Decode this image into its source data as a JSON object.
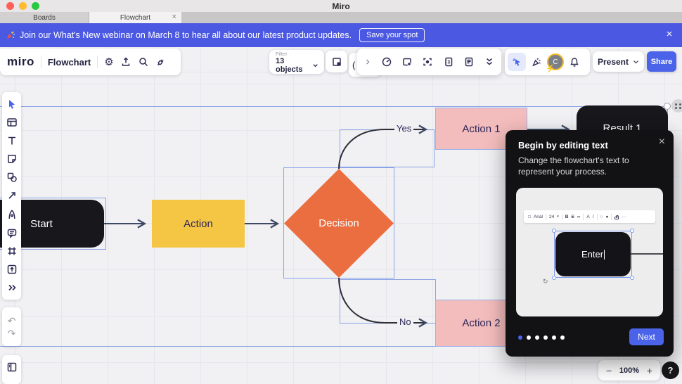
{
  "window": {
    "title": "Miro"
  },
  "tabs": {
    "items": [
      {
        "label": "Boards"
      },
      {
        "label": "Flowchart",
        "close": "×"
      }
    ]
  },
  "banner": {
    "message": "Join our What's New webinar on March 8 to hear all about our latest product updates.",
    "cta": "Save your spot",
    "close": "×"
  },
  "app_toolbar": {
    "logo": "miro",
    "board_title": "Flowchart"
  },
  "filter": {
    "label": "Filter",
    "value": "13 objects"
  },
  "hidden_panel": {
    "partial_text": "("
  },
  "collab_bar": {
    "present": "Present",
    "share": "Share",
    "avatar_initial": "C"
  },
  "canvas": {
    "zoom_out": "−",
    "zoom_value": "100%",
    "zoom_in": "+",
    "help": "?",
    "flowchart": {
      "nodes": [
        {
          "label": "Start",
          "type": "terminator",
          "color": "#17171c"
        },
        {
          "label": "Action",
          "type": "process",
          "color": "#f5c644"
        },
        {
          "label": "Decision",
          "type": "decision",
          "color": "#eb6e41"
        },
        {
          "label": "Action 1",
          "type": "process",
          "color": "#f4bdbd"
        },
        {
          "label": "Action 2",
          "type": "process",
          "color": "#f4bdbd"
        },
        {
          "label": "Result 1",
          "type": "terminator",
          "color": "#17171c"
        }
      ],
      "edge_labels": {
        "yes": "Yes",
        "no": "No"
      },
      "selected_object_count": "13 objects"
    }
  },
  "tooltip": {
    "title": "Begin by editing text",
    "body": "Change the flowchart's text to represent your process.",
    "close": "×",
    "next": "Next",
    "pagination": {
      "count": 6,
      "active_index": 0
    },
    "preview": {
      "node_label": "Enter",
      "toolbar": {
        "font": "Arial",
        "size": "24",
        "bold": "B",
        "strike": "S",
        "link": "∞",
        "color_letter": "A",
        "pen": "/",
        "more": "···"
      }
    }
  },
  "icons": {
    "gear": "⚙",
    "undo": "↶",
    "redo": "↷",
    "lightning": "⚡",
    "rotate": "↻",
    "stepper": "▾",
    "circle_outline": "○",
    "circle_filled": "●",
    "square_outline": "□"
  },
  "colors": {
    "accent_blue": "#4a63e9",
    "banner_blue": "#4b58e2",
    "selection_blue": "#8aa3e6",
    "node_black": "#17171c",
    "node_yellow": "#f5c644",
    "node_orange": "#eb6e41",
    "node_pink": "#f4bdbd",
    "canvas_bg": "#f1f1f4",
    "tooltip_bg": "#121215"
  }
}
